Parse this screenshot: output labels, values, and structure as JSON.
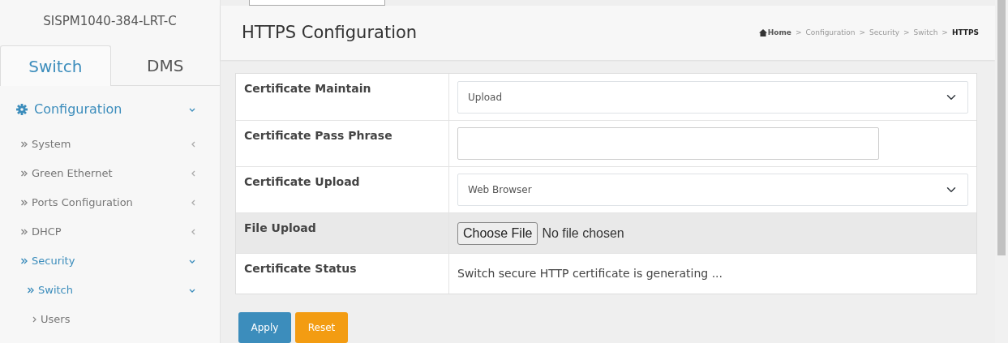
{
  "sidebar": {
    "device_name": "SISPM1040-384-LRT-C",
    "tabs": [
      {
        "label": "Switch",
        "selected": true
      },
      {
        "label": "DMS",
        "selected": false
      }
    ],
    "menu": [
      {
        "label": "Configuration",
        "expanded": true,
        "active": true,
        "children": [
          {
            "label": "System",
            "expanded": false,
            "active": false
          },
          {
            "label": "Green Ethernet",
            "expanded": false,
            "active": false
          },
          {
            "label": "Ports Configuration",
            "expanded": false,
            "active": false
          },
          {
            "label": "DHCP",
            "expanded": false,
            "active": false
          },
          {
            "label": "Security",
            "expanded": true,
            "active": true,
            "children": [
              {
                "label": "Switch",
                "expanded": true,
                "active": true,
                "children": [
                  {
                    "label": "Users"
                  }
                ]
              }
            ]
          }
        ]
      }
    ]
  },
  "page": {
    "title": "HTTPS Configuration",
    "breadcrumb": {
      "separator": ">",
      "items": [
        {
          "label": "Home",
          "current": false
        },
        {
          "label": "Configuration",
          "current": false
        },
        {
          "label": "Security",
          "current": false
        },
        {
          "label": "Switch",
          "current": false
        },
        {
          "label": "HTTPS",
          "current": true
        }
      ]
    },
    "rows": [
      {
        "kind": "select",
        "label": "Certificate Maintain",
        "value": "Upload",
        "highlighted": false
      },
      {
        "kind": "text",
        "label": "Certificate Pass Phrase",
        "highlighted": false
      },
      {
        "kind": "select",
        "label": "Certificate Upload",
        "value": "Web Browser",
        "highlighted": false
      },
      {
        "kind": "file",
        "label": "File Upload",
        "button": "Choose File",
        "status": "No file chosen",
        "highlighted": true
      },
      {
        "kind": "static",
        "label": "Certificate Status",
        "value": "Switch secure HTTP certificate is generating ...",
        "highlighted": false
      }
    ],
    "buttons": [
      {
        "label": "Apply",
        "kind": "primary"
      },
      {
        "label": "Reset",
        "kind": "warning"
      }
    ]
  }
}
